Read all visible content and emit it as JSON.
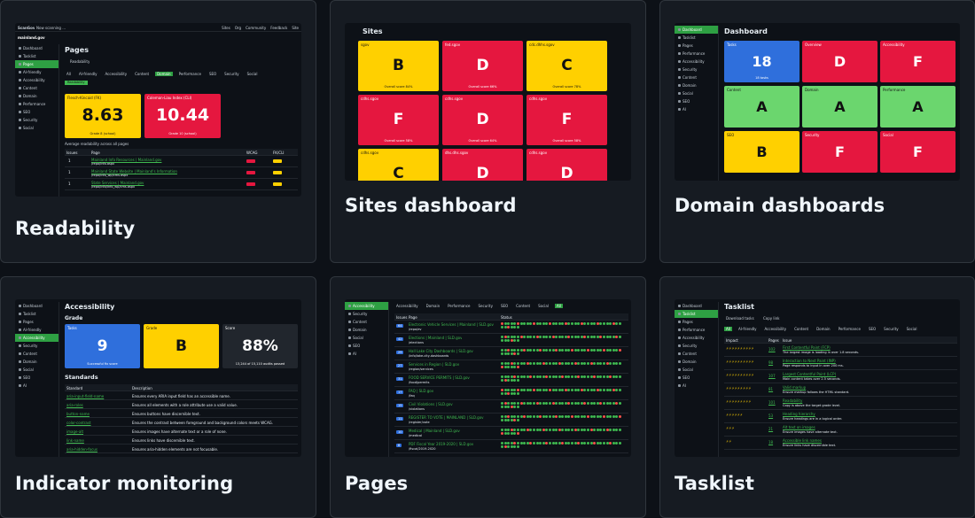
{
  "cards": [
    {
      "title": "Readability"
    },
    {
      "title": "Sites dashboard"
    },
    {
      "title": "Domain dashboards"
    },
    {
      "title": "Indicator monitoring"
    },
    {
      "title": "Pages"
    },
    {
      "title": "Tasklist"
    }
  ],
  "readability": {
    "app": "ScanGov",
    "status": "Now scanning ...",
    "nav": [
      "Sites",
      "Org",
      "Community",
      "Feedback",
      "Site"
    ],
    "site": "mainland.gov",
    "heading": "Pages",
    "sub_link": "Readability",
    "tabs": [
      "All",
      "AI-friendly",
      "Accessibility",
      "Content",
      "Domain",
      "Performance",
      "SEO",
      "Security",
      "Social"
    ],
    "tag": "Readability",
    "sidebar": [
      "Dashboard",
      "Tasklist",
      "Pages",
      "AI-friendly",
      "Accessibility",
      "Content",
      "Domain",
      "Performance",
      "SEO",
      "Security",
      "Social"
    ],
    "tile1": {
      "label": "Flesch-Kincaid (FK)",
      "value": "8.63",
      "sub": "Grade 8 (school)"
    },
    "tile2": {
      "label": "Coleman-Liau Index (CLI)",
      "value": "10.44",
      "sub": "Grade 10 (school)"
    },
    "note": "Average readability across all pages",
    "cols": [
      "Issues",
      "Page",
      "WCAG",
      "FK/CLI"
    ],
    "rows": [
      {
        "n": "1",
        "page": "Mainland Info Resources | Mainland.gov",
        "url": "/repo/info.aspx"
      },
      {
        "n": "1",
        "page": "Mainland State Website | Mainland's Information",
        "url": "/repo/info_wp/cms.aspx"
      },
      {
        "n": "1",
        "page": "State Services | Mainland.gov",
        "url": "/repo/info/info_wp/cms.aspx"
      }
    ]
  },
  "sites": {
    "heading": "Sites",
    "tiles": [
      {
        "label": "sgov",
        "grade": "B",
        "sub": "Overall score 84%",
        "color": "y"
      },
      {
        "label": "fed.sgov",
        "grade": "D",
        "sub": "Overall score 66%",
        "color": "r"
      },
      {
        "label": "cdc.dhhs.sgov",
        "grade": "C",
        "sub": "Overall score 78%",
        "color": "y"
      },
      {
        "label": "cdhs.sgov",
        "grade": "F",
        "sub": "Overall score 58%",
        "color": "r"
      },
      {
        "label": "cdhs.sgov",
        "grade": "D",
        "sub": "Overall score 64%",
        "color": "r"
      },
      {
        "label": "cdhs.sgov",
        "grade": "F",
        "sub": "Overall score 58%",
        "color": "r"
      },
      {
        "label": "cdhs.sgov",
        "grade": "C",
        "sub": "",
        "color": "y"
      },
      {
        "label": "dhs.dhs.sgov",
        "grade": "D",
        "sub": "",
        "color": "r"
      },
      {
        "label": "cdhs.sgov",
        "grade": "D",
        "sub": "",
        "color": "r"
      }
    ]
  },
  "domain": {
    "heading": "Dashboard",
    "sidebar": [
      "Dashboard",
      "Tasklist",
      "Pages",
      "Performance",
      "Accessibility",
      "Security",
      "Content",
      "Domain",
      "Social",
      "SEO",
      "AI"
    ],
    "tiles": [
      {
        "label": "Tasks",
        "grade": "18",
        "sub": "18 tasks",
        "color": "b"
      },
      {
        "label": "Overview",
        "grade": "D",
        "sub": "",
        "color": "r"
      },
      {
        "label": "Accessibility",
        "grade": "F",
        "sub": "",
        "color": "r"
      },
      {
        "label": "Content",
        "grade": "A",
        "sub": "",
        "color": "g"
      },
      {
        "label": "Domain",
        "grade": "A",
        "sub": "",
        "color": "g"
      },
      {
        "label": "Performance",
        "grade": "A",
        "sub": "",
        "color": "g"
      },
      {
        "label": "SEO",
        "grade": "B",
        "sub": "",
        "color": "y"
      },
      {
        "label": "Security",
        "grade": "F",
        "sub": "",
        "color": "r"
      },
      {
        "label": "Social",
        "grade": "F",
        "sub": "",
        "color": "r"
      }
    ]
  },
  "indicator": {
    "heading": "Accessibility",
    "grade_heading": "Grade",
    "sidebar": [
      "Dashboard",
      "Tasklist",
      "Pages",
      "AI-friendly",
      "Accessibility",
      "Security",
      "Content",
      "Domain",
      "Social",
      "SEO",
      "AI"
    ],
    "tiles": [
      {
        "label": "Tasks",
        "value": "9",
        "sub": "Successful fix score",
        "color": "b"
      },
      {
        "label": "Grade",
        "value": "B",
        "sub": "",
        "color": "y"
      },
      {
        "label": "Score",
        "value": "88%",
        "sub": "13,244 of 15,110 audits passed",
        "color": "dk"
      }
    ],
    "std_heading": "Standards",
    "cols": [
      "Standard",
      "Description"
    ],
    "rows": [
      {
        "std": "aria-input-field-name",
        "desc": "Ensures every ARIA input field has an accessible name."
      },
      {
        "std": "aria-roles",
        "desc": "Ensures all elements with a role attribute use a valid value."
      },
      {
        "std": "button-name",
        "desc": "Ensures buttons have discernible text."
      },
      {
        "std": "color-contrast",
        "desc": "Ensures the contrast between foreground and background colors meets WCAG."
      },
      {
        "std": "image-alt",
        "desc": "Ensures images have alternate text or a role of none."
      },
      {
        "std": "link-name",
        "desc": "Ensures links have discernible text."
      },
      {
        "std": "aria-hidden-focus",
        "desc": "Ensures aria-hidden elements are not focusable."
      }
    ]
  },
  "pages": {
    "sidebar": [
      "Accessibility",
      "Security",
      "Content",
      "Domain",
      "Social",
      "SEO",
      "AI"
    ],
    "tabs": [
      "Accessibility",
      "Domain",
      "Performance",
      "Security",
      "SEO",
      "Content",
      "Social",
      "All"
    ],
    "cols": [
      "Issues",
      "Page",
      "Status"
    ],
    "rows": [
      {
        "n": "64",
        "page": "Electronic Vehicle Services | Mainland | SLD.gov",
        "url": "/repo/ev"
      },
      {
        "n": "42",
        "page": "Elections | Mainland | SLD.gov",
        "url": "/elections"
      },
      {
        "n": "29",
        "page": "Hall Lake City Dashboards | SLD.gov",
        "url": "/info/lake-city-dashboards"
      },
      {
        "n": "27",
        "page": "Services in Region | SLD.gov",
        "url": "/region/services"
      },
      {
        "n": "31",
        "page": "FOOD SERVICE PERMITS | SLD.gov",
        "url": "/food/permits"
      },
      {
        "n": "17",
        "page": "FAQ | SLD.gov",
        "url": "/faq"
      },
      {
        "n": "15",
        "page": "Civil Violations | SLD.gov",
        "url": "/violations"
      },
      {
        "n": "11",
        "page": "REGISTER TO VOTE | MAINLAND | SLD.gov",
        "url": "/register/vote"
      },
      {
        "n": "10",
        "page": "Medical | Mainland | SLD.gov",
        "url": "/medical"
      },
      {
        "n": "8",
        "page": "PDF Fiscal Year 2019-2020 | SLD.gov",
        "url": "/fiscal/2019-2020"
      }
    ]
  },
  "tasklist": {
    "heading": "Tasklist",
    "actions": [
      "Download tasks",
      "Copy link"
    ],
    "sidebar": [
      "Dashboard",
      "Tasklist",
      "Pages",
      "Performance",
      "Accessibility",
      "Security",
      "Content",
      "Domain",
      "Social",
      "SEO",
      "AI"
    ],
    "tabs": [
      "All",
      "AI-friendly",
      "Accessibility",
      "Content",
      "Domain",
      "Performance",
      "SEO",
      "Security",
      "Social"
    ],
    "cols": [
      "Impact",
      "Pages",
      "Issue"
    ],
    "rows": [
      {
        "impact": "⚡⚡⚡⚡⚡⚡⚡⚡⚡⚡",
        "pages": "102",
        "issue": "First Contentful Paint (FCP)",
        "desc": "The largest image is loading in over 1.8 seconds."
      },
      {
        "impact": "⚡⚡⚡⚡⚡⚡⚡⚡⚡⚡",
        "pages": "98",
        "issue": "Interaction to Next Paint (INP)",
        "desc": "Page responds to input in over 200 ms."
      },
      {
        "impact": "⚡⚡⚡⚡⚡⚡⚡⚡⚡⚡",
        "pages": "107",
        "issue": "Largest Contentful Paint (LCP)",
        "desc": "Main content takes over 2.5 seconds."
      },
      {
        "impact": "⚡⚡⚡⚡⚡⚡⚡⚡⚡",
        "pages": "81",
        "issue": "Valid markup",
        "desc": "Ensure markup follows the HTML standard."
      },
      {
        "impact": "⚡⚡⚡⚡⚡⚡⚡⚡⚡",
        "pages": "101",
        "issue": "Readability",
        "desc": "Copy is above the target grade level."
      },
      {
        "impact": "⚡⚡⚡⚡⚡⚡",
        "pages": "53",
        "issue": "Heading hierarchy",
        "desc": "Ensure headings are in a logical order."
      },
      {
        "impact": "⚡⚡⚡",
        "pages": "21",
        "issue": "Alt text on images",
        "desc": "Ensure images have alternate text."
      },
      {
        "impact": "⚡⚡",
        "pages": "18",
        "issue": "Accessible link names",
        "desc": "Ensure links have discernible text."
      }
    ]
  }
}
